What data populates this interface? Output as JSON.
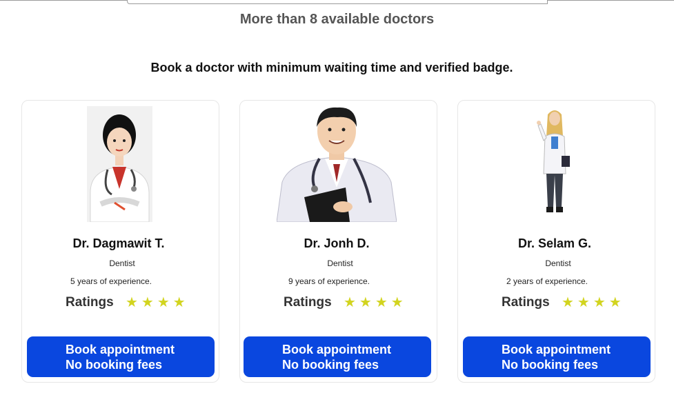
{
  "header": {
    "count_text": "More than 8 available doctors",
    "tagline": "Book a doctor with minimum waiting time and verified badge."
  },
  "doctors": [
    {
      "name": "Dr. Dagmawit T.",
      "specialty": "Dentist",
      "experience": "5 years of experience.",
      "ratings_label": "Ratings",
      "stars": "★★★★",
      "rating": 4,
      "button_line1": "Book appointment",
      "button_line2": "No booking fees"
    },
    {
      "name": "Dr. Jonh D.",
      "specialty": "Dentist",
      "experience": "9 years of experience.",
      "ratings_label": "Ratings",
      "stars": "★★★★",
      "rating": 4,
      "button_line1": "Book appointment",
      "button_line2": "No booking fees"
    },
    {
      "name": "Dr. Selam G.",
      "specialty": "Dentist",
      "experience": "2 years of experience.",
      "ratings_label": "Ratings",
      "stars": "★★★★",
      "rating": 4,
      "button_line1": "Book appointment",
      "button_line2": "No booking fees"
    }
  ],
  "colors": {
    "button_bg": "#0a47df",
    "star": "#d2d41f",
    "card_border": "#e6e6e6"
  }
}
